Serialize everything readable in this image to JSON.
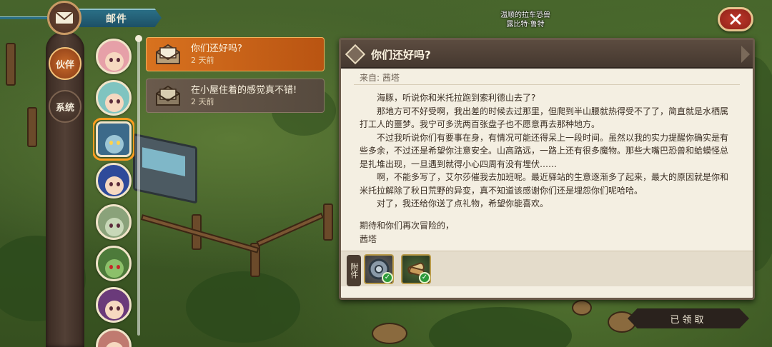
{
  "header": {
    "title": "邮件"
  },
  "location": {
    "line1": "温顺的拉车恐兽",
    "line2": "露比特·鲁特"
  },
  "categories": [
    {
      "label": "伙伴",
      "active": true
    },
    {
      "label": "系统",
      "active": false
    }
  ],
  "mail_list": [
    {
      "subject": "你们还好吗?",
      "time": "2 天前",
      "active": true
    },
    {
      "subject": "在小屋住着的感觉真不错!",
      "time": "2 天前",
      "active": false
    }
  ],
  "letter": {
    "title": "你们还好吗?",
    "from": "来自: 茜塔",
    "paragraphs": [
      "海豚，听说你和米托拉跑到索利德山去了?",
      "那地方可不好受啊，我出差的时候去过那里，但爬到半山腰就热得受不了了，简直就是水栖属打工人的噩梦。我宁可多洗两百张盘子也不愿意再去那种地方。",
      "不过我听说你们有要事在身，有情况可能还得呆上一段时间。虽然以我的实力提醒你确实是有些多余，不过还是希望你注意安全。山高路远，一路上还有很多魔物。那些大嘴巴恐兽和蛤蟆怪总是扎堆出现，一旦遇到就得小心四周有没有埋伏……",
      "啊，不能多写了，艾尔莎催我去加班呢。最近驿站的生意逐渐多了起来，最大的原因就是你和米托拉解除了秋日荒野的异变，真不知道该感谢你们还是埋怨你们呢哈哈。",
      "对了，我还给你送了点礼物，希望你能喜欢。"
    ],
    "closing": "期待和你们再次冒险的，",
    "signature": "茜塔",
    "attachments_label": "附件",
    "attachments": [
      {
        "icon": "shield-disc-icon",
        "claimed": true
      },
      {
        "icon": "scroll-bundle-icon",
        "claimed": true
      }
    ]
  },
  "claim_button": {
    "label": "已领取"
  },
  "colors": {
    "accent_orange": "#d8721f",
    "banner_teal": "#2a6f86",
    "close_red": "#c0392b",
    "paper": "#f4efe2"
  }
}
